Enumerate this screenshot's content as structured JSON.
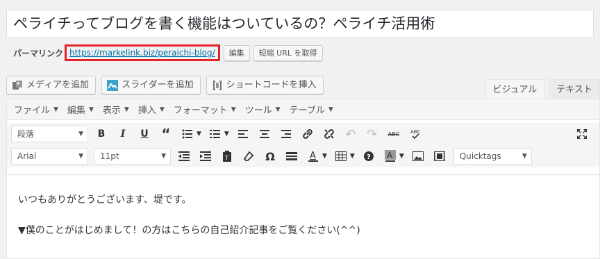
{
  "title": "ペライチってブログを書く機能はついているの？ペライチ活用術",
  "permalink": {
    "label": "パーマリンク",
    "url": "https://markelink.biz/peraichi-blog/",
    "edit_label": "編集",
    "shortlink_label": "短縮 URL を取得"
  },
  "media_buttons": {
    "add_media": "メディアを追加",
    "add_slider": "スライダーを追加",
    "insert_shortcode": "ショートコードを挿入"
  },
  "tabs": {
    "visual": "ビジュアル",
    "text": "テキスト"
  },
  "menubar": [
    "ファイル",
    "編集",
    "表示",
    "挿入",
    "フォーマット",
    "ツール",
    "テーブル"
  ],
  "toolbar": {
    "format_select": "段落",
    "font_select": "Arial",
    "size_select": "11pt",
    "quicktags_select": "Quicktags"
  },
  "content": {
    "paragraphs": [
      "いつもありがとうございます、堤です。",
      "▼僕のことがはじめまして！の方はこちらの自己紹介記事をご覧ください(^^)"
    ]
  },
  "colors": {
    "highlight": "#e3222a",
    "link": "#0073aa"
  }
}
